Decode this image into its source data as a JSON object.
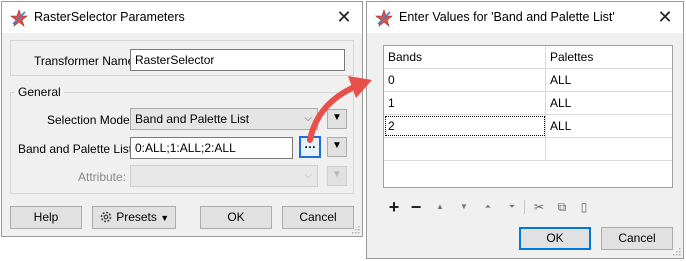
{
  "dialog1": {
    "title": "RasterSelector Parameters",
    "transformer_name_label": "Transformer Name:",
    "transformer_name_value": "RasterSelector",
    "group_title": "General",
    "selection_mode_label": "Selection Mode:",
    "selection_mode_value": "Band and Palette List",
    "band_palette_label": "Band and Palette List:",
    "band_palette_value": "0:ALL;1:ALL;2:ALL",
    "attribute_label": "Attribute:",
    "attribute_value": "",
    "help_label": "Help",
    "presets_label": "Presets",
    "ok_label": "OK",
    "cancel_label": "Cancel"
  },
  "dialog2": {
    "title": "Enter Values for 'Band and Palette List'",
    "columns": [
      "Bands",
      "Palettes"
    ],
    "rows": [
      [
        "0",
        "ALL"
      ],
      [
        "1",
        "ALL"
      ],
      [
        "2",
        "ALL"
      ],
      [
        "",
        ""
      ]
    ],
    "ok_label": "OK",
    "cancel_label": "Cancel"
  },
  "icons": {
    "app_icon": "fme-logo-icon",
    "close": "close-icon",
    "dropdown": "chevron-down-icon",
    "ellipsis": "ellipsis-icon",
    "add": "add-icon",
    "remove": "remove-icon",
    "move_up": "move-up-icon",
    "move_down": "move-down-icon",
    "move_top": "move-to-top-icon",
    "move_bottom": "move-to-bottom-icon",
    "cut": "cut-icon",
    "copy": "copy-icon",
    "paste": "paste-icon",
    "gear": "gear-icon"
  },
  "colors": {
    "dialog_bg": "#f0f0f0",
    "accent_blue": "#0078d7",
    "callout_arrow": "#e8504a"
  }
}
